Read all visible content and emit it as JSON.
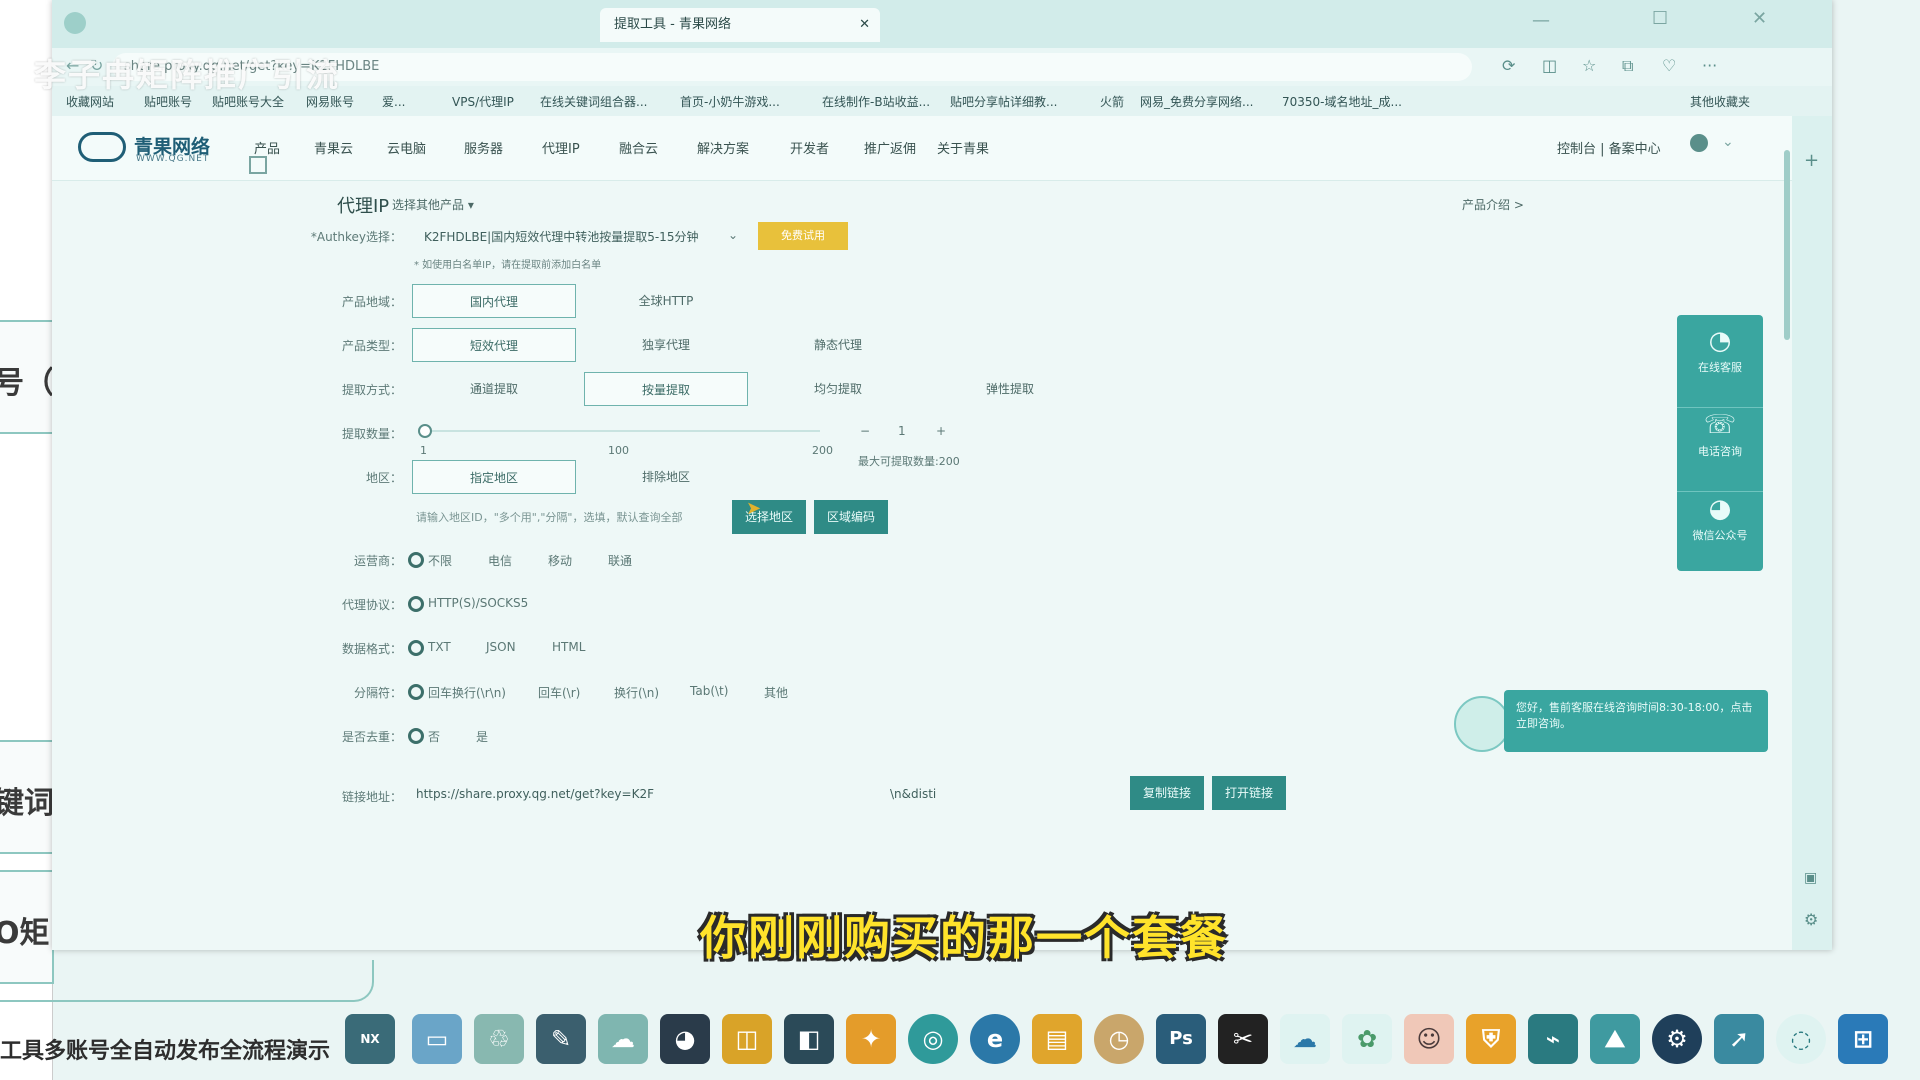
{
  "overlay": {
    "watermark": "李子冉矩阵推广引流",
    "subtitle": "你刚刚购买的那一个套餐"
  },
  "left_app": {
    "texts": [
      "号（搜",
      "键词搜",
      "O矩"
    ],
    "bottom_title": "工具多账号全自动发布全流程演示"
  },
  "browser": {
    "tabs": [
      {
        "label": "提取工具 - 青果网络",
        "active": true
      },
      {
        "label": "",
        "active": false
      },
      {
        "label": "",
        "active": false
      }
    ],
    "address": "share.proxy.qg.net/get?key=K2FHDLBE",
    "bookmarks": [
      "收藏网站",
      "贴吧账号",
      "贴吧账号大全",
      "网易账号",
      "爱...",
      "VPS/代理IP",
      "在线关键词组合器...",
      "首页-小奶牛游戏...",
      "在线制作-B站收益...",
      "贴吧分享帖详细教...",
      "火箭",
      "网易_免费分享网络...",
      "70350-域名地址_成...",
      "其他收藏夹"
    ]
  },
  "site": {
    "logo": "青果网络",
    "logo_sub": "WWW.QG.NET",
    "nav": [
      "产品",
      "青果云",
      "云电脑",
      "服务器",
      "代理IP",
      "融合云",
      "解决方案",
      "开发者",
      "推广返佣",
      "关于青果"
    ],
    "nav_right": "控制台 | 备案中心"
  },
  "product": {
    "title": "代理IP",
    "other": "选择其他产品",
    "intro": "产品介绍 >"
  },
  "form": {
    "authkey_label": "*Authkey选择：",
    "authkey_value": "K2FHDLBE|国内短效代理中转池按量提取5-15分钟",
    "authkey_btn": "免费试用",
    "authkey_note": "* 如使用白名单IP，请在提取前添加白名单",
    "region_label": "产品地域：",
    "region_opts": [
      "国内代理",
      "全球HTTP"
    ],
    "type_label": "产品类型：",
    "type_opts": [
      "短效代理",
      "独享代理",
      "静态代理"
    ],
    "method_label": "提取方式：",
    "method_opts": [
      "通道提取",
      "按量提取",
      "均匀提取",
      "弹性提取"
    ],
    "qty_label": "提取数量：",
    "qty_ticks": [
      "1",
      "100",
      "200"
    ],
    "qty_value": "1",
    "qty_minus": "−",
    "qty_plus": "+",
    "qty_max": "最大可提取数量:200",
    "area_label": "地区：",
    "area_opts": [
      "指定地区",
      "排除地区"
    ],
    "area_placeholder": "请输入地区ID，\"多个用\",\"分隔\"，选填，默认查询全部",
    "area_btn1": "选择地区",
    "area_btn2": "区域编码",
    "isp_label": "运营商：",
    "isp_opts": [
      "不限",
      "电信",
      "移动",
      "联通"
    ],
    "proto_label": "代理协议：",
    "proto_opts": [
      "HTTP(S)/SOCKS5"
    ],
    "fmt_label": "数据格式：",
    "fmt_opts": [
      "TXT",
      "JSON",
      "HTML"
    ],
    "sep_label": "分隔符：",
    "sep_opts": [
      "回车换行(\\r\\n)",
      "回车(\\r)",
      "换行(\\n)",
      "Tab(\\t)",
      "其他"
    ],
    "dedup_label": "是否去重：",
    "dedup_opts": [
      "否",
      "是"
    ],
    "link_label": "链接地址：",
    "link_value": "https://share.proxy.qg.net/get?key=K2F",
    "link_tail": "\\n&disti",
    "copy_btn": "复制链接",
    "open_btn": "打开链接"
  },
  "widget": {
    "items": [
      "在线客服",
      "电话咨询",
      "微信公众号"
    ],
    "chat": "您好，售前客服在线咨询时间8:30-18:00，点击立即咨询。"
  },
  "taskbar": {
    "icons": [
      "nexus",
      "pc",
      "bin",
      "note",
      "chat",
      "qq",
      "app",
      "vs",
      "game",
      "chrome",
      "edge",
      "box",
      "clock",
      "Ps",
      "cut",
      "cloud",
      "flower",
      "girl",
      "shield",
      "net",
      "mnt",
      "steam",
      "arrow",
      "ring",
      "win"
    ]
  }
}
